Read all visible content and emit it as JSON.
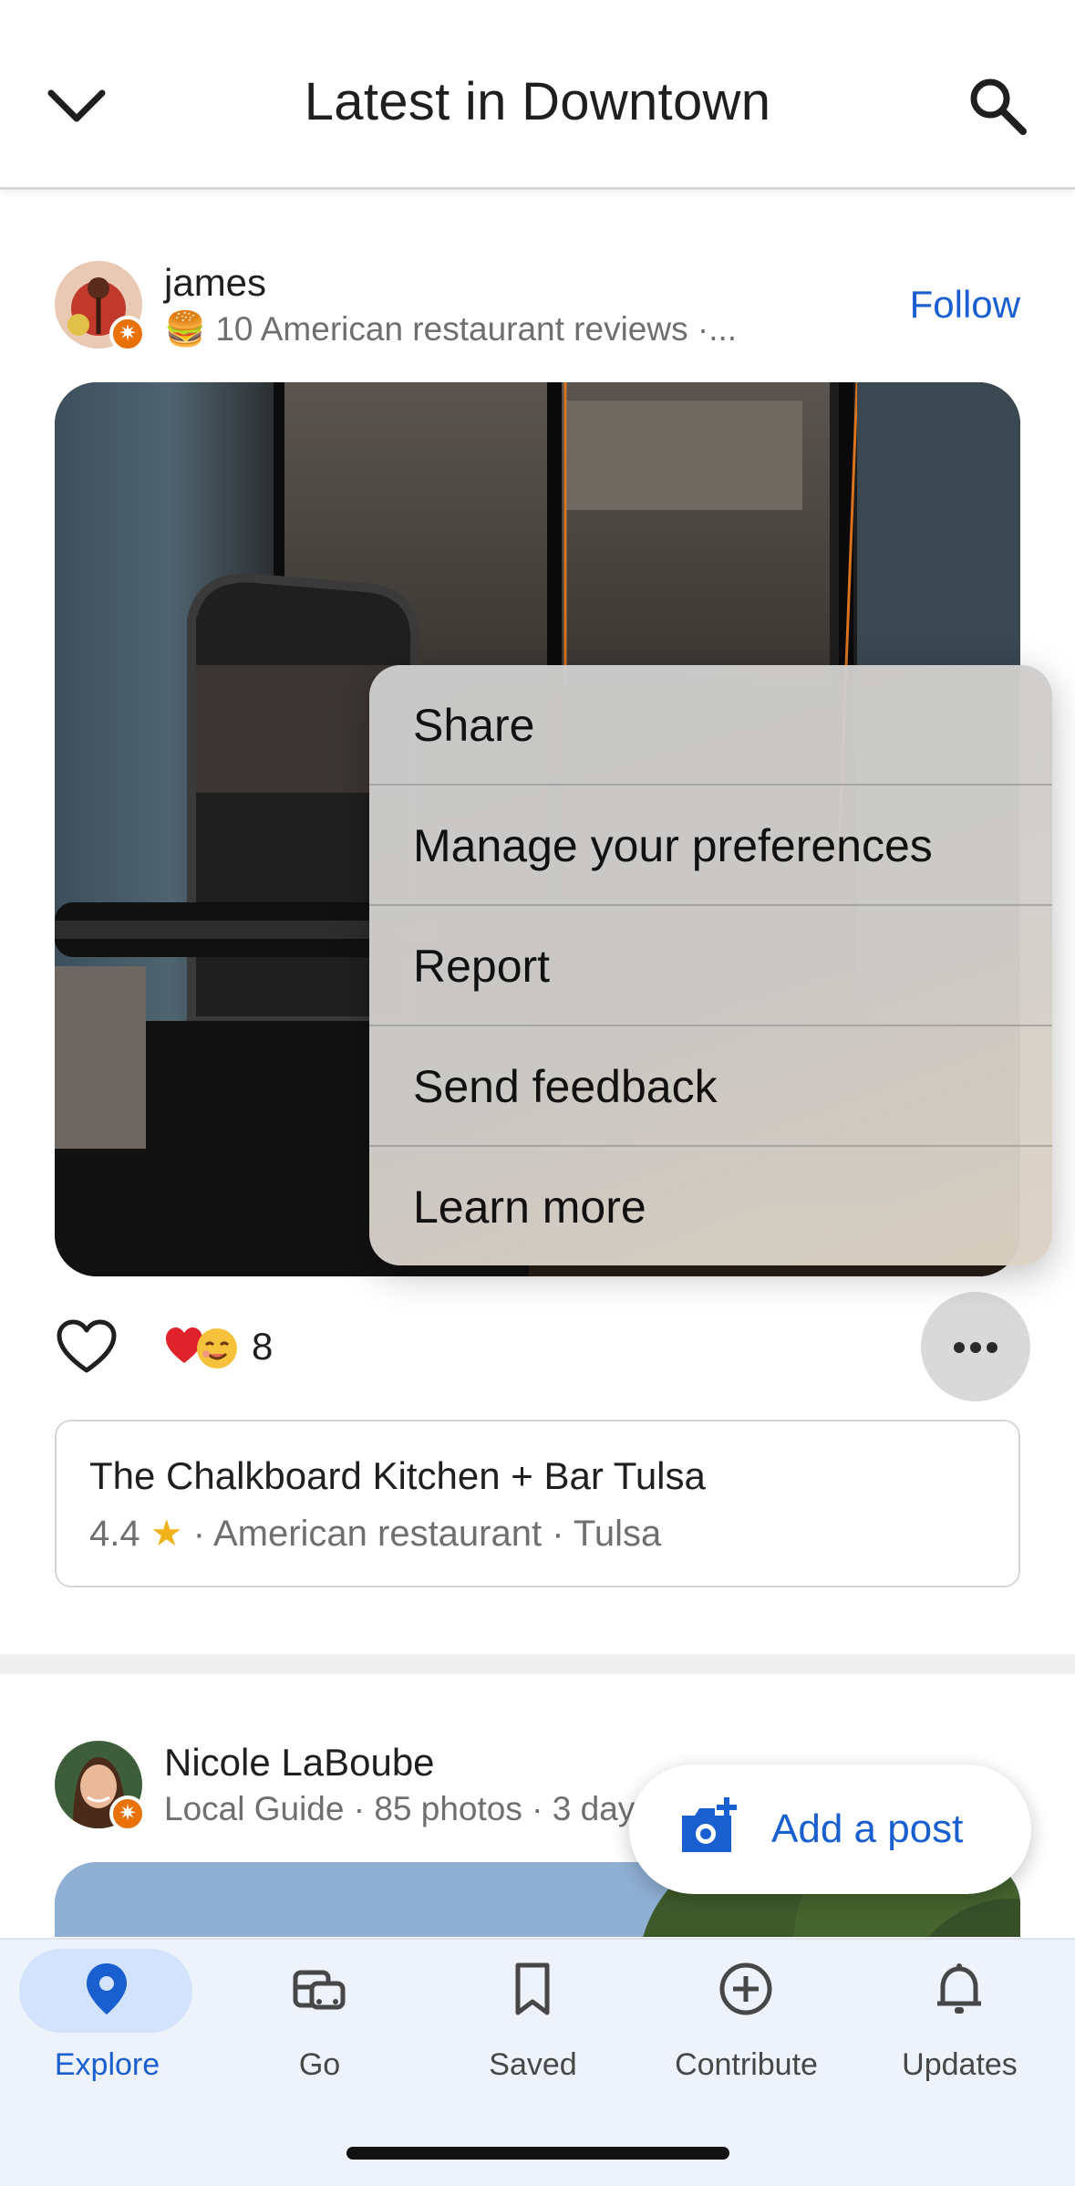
{
  "header": {
    "title": "Latest in Downtown",
    "back_icon": "chevron-down-icon",
    "search_icon": "search-icon"
  },
  "posts": [
    {
      "author": "james",
      "meta_emoji": "🍔",
      "meta": "10 American restaurant reviews ·...",
      "follow_label": "Follow",
      "reaction_count": "8",
      "place": {
        "name": "The Chalkboard Kitchen + Bar Tulsa",
        "rating": "4.4",
        "star": "★",
        "details": "· American restaurant · Tulsa"
      }
    },
    {
      "author": "Nicole LaBoube",
      "meta": "Local Guide · 85 photos · 3 day"
    }
  ],
  "context_menu": {
    "items": [
      {
        "label": "Share"
      },
      {
        "label": "Manage your preferences"
      },
      {
        "label": "Report"
      },
      {
        "label": "Send feedback"
      },
      {
        "label": "Learn more"
      }
    ]
  },
  "fab": {
    "label": "Add a post",
    "icon": "add-photo-icon"
  },
  "bottom_nav": {
    "items": [
      {
        "label": "Explore",
        "icon": "location-pin-icon",
        "active": true
      },
      {
        "label": "Go",
        "icon": "commute-icon",
        "active": false
      },
      {
        "label": "Saved",
        "icon": "bookmark-icon",
        "active": false
      },
      {
        "label": "Contribute",
        "icon": "add-circle-icon",
        "active": false
      },
      {
        "label": "Updates",
        "icon": "bell-icon",
        "active": false
      }
    ]
  },
  "colors": {
    "accent": "#1a5fd0",
    "active_pill": "#d3e3fd",
    "nav_bg": "#eef2fa",
    "local_guide_badge": "#e8710a",
    "star": "#f2b21c"
  }
}
